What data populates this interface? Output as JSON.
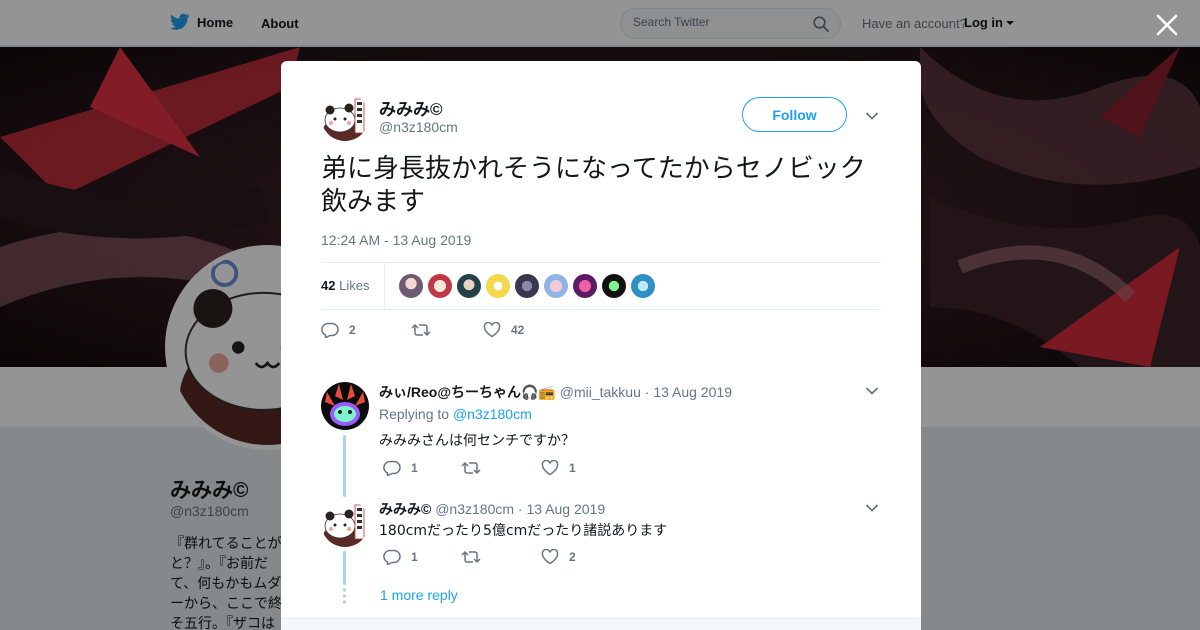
{
  "topbar": {
    "home_label": "Home",
    "about_label": "About",
    "search_placeholder": "Search Twitter",
    "have_account": "Have an account?",
    "login_label": "Log in"
  },
  "profile": {
    "name": "みみみ©",
    "handle": "@n3z180cm",
    "bio_visible": "『群れてることが\nと？』。『お前だ\nて、何もかもムダ\nーから、ここで終\nそ五行。『ザコは"
  },
  "tweet": {
    "name": "みみみ©",
    "handle": "@n3z180cm",
    "follow_label": "Follow",
    "text": "弟に身長抜かれそうになってたからセノビック飲みます",
    "timestamp": "12:24 AM - 13 Aug 2019",
    "likes_count": "42",
    "likes_label": "Likes",
    "reply_count": "2",
    "retweet_count": "",
    "like_count": "42"
  },
  "replies": [
    {
      "name": "みぃ/Reo@ちーちゃん🎧📻",
      "handle": "@mii_takkuu",
      "date": "13 Aug 2019",
      "replying_to_label": "Replying to",
      "replying_to": "@n3z180cm",
      "text": "みみみさんは何センチですか？",
      "reply_count": "1",
      "like_count": "1"
    },
    {
      "name": "みみみ©",
      "handle": "@n3z180cm",
      "date": "13 Aug 2019",
      "text": "180cmだったり5億cmだったり諸説あります",
      "reply_count": "1",
      "like_count": "2"
    }
  ],
  "more_replies_label": "1 more reply",
  "colors": {
    "brand_blue": "#1da1f2",
    "thread_line": "#a3d5f8",
    "muted_text": "#657786"
  },
  "icons": [
    "twitter-bird-icon",
    "search-icon",
    "close-icon",
    "chevron-down-icon",
    "reply-icon",
    "retweet-icon",
    "heart-icon"
  ]
}
